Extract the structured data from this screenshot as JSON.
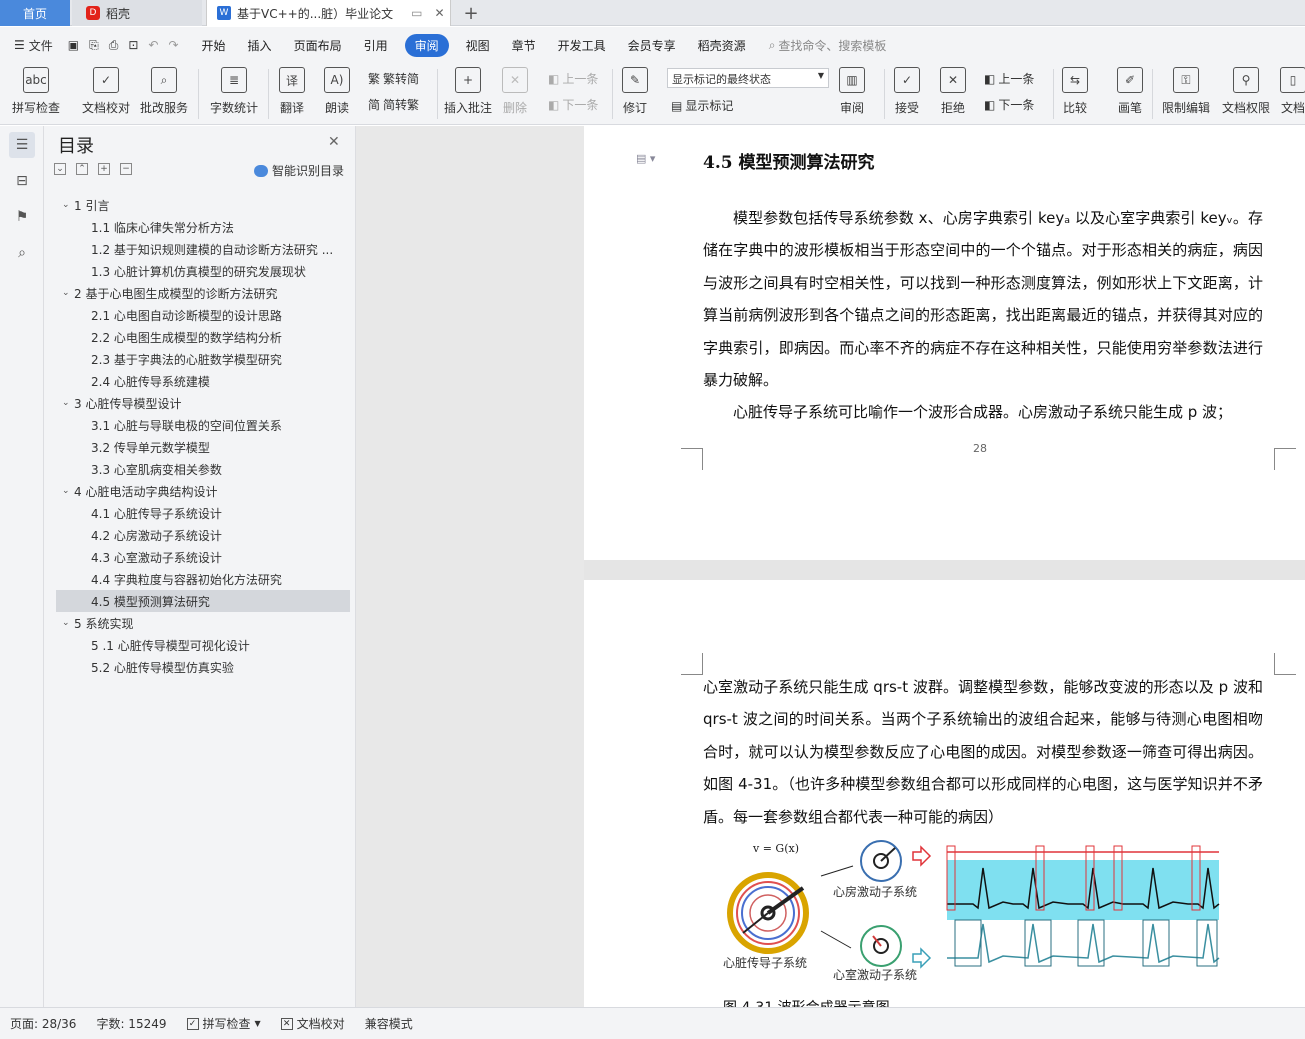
{
  "tabs": {
    "home": "首页",
    "daoke": "稻壳",
    "doc": "基于VC++的...脏）毕业论文",
    "add": "+"
  },
  "menubar": {
    "file": "文件",
    "items": [
      "开始",
      "插入",
      "页面布局",
      "引用",
      "审阅",
      "视图",
      "章节",
      "开发工具",
      "会员专享",
      "稻壳资源"
    ],
    "active": "审阅",
    "search": "查找命令、搜索模板"
  },
  "ribbon": {
    "spell": "拼写检查",
    "proof": "文档校对",
    "correct": "批改服务",
    "wordcount": "字数统计",
    "translate": "翻译",
    "read": "朗读",
    "t2s": "繁转简",
    "s2t": "简转繁",
    "comment": "插入批注",
    "delete": "删除",
    "prev": "上一条",
    "next": "下一条",
    "revise": "修订",
    "markup_mode": "显示标记的最终状态",
    "show_markup": "显示标记",
    "review": "审阅",
    "accept": "接受",
    "reject": "拒绝",
    "prev2": "上一条",
    "next2": "下一条",
    "compare": "比较",
    "pen": "画笔",
    "restrict": "限制编辑",
    "permission": "文档权限",
    "doc_more": "文档"
  },
  "toc": {
    "title": "目录",
    "smart": "智能识别目录",
    "items": [
      {
        "level": 1,
        "text": "1 引言"
      },
      {
        "level": 2,
        "text": "1.1 临床心律失常分析方法"
      },
      {
        "level": 2,
        "text": "1.2 基于知识规则建模的自动诊断方法研究 ..."
      },
      {
        "level": 2,
        "text": "1.3 心脏计算机仿真模型的研究发展现状"
      },
      {
        "level": 1,
        "text": "2 基于心电图生成模型的诊断方法研究"
      },
      {
        "level": 2,
        "text": "2.1 心电图自动诊断模型的设计思路"
      },
      {
        "level": 2,
        "text": "2.2 心电图生成模型的数学结构分析"
      },
      {
        "level": 2,
        "text": "2.3 基于字典法的心脏数学模型研究"
      },
      {
        "level": 2,
        "text": "2.4 心脏传导系统建模"
      },
      {
        "level": 1,
        "text": "3 心脏传导模型设计"
      },
      {
        "level": 2,
        "text": "3.1 心脏与导联电极的空间位置关系"
      },
      {
        "level": 2,
        "text": "3.2 传导单元数学模型"
      },
      {
        "level": 2,
        "text": "3.3 心室肌病变相关参数"
      },
      {
        "level": 1,
        "text": "4 心脏电活动字典结构设计"
      },
      {
        "level": 2,
        "text": "4.1 心脏传导子系统设计"
      },
      {
        "level": 2,
        "text": "4.2 心房激动子系统设计"
      },
      {
        "level": 2,
        "text": "4.3 心室激动子系统设计"
      },
      {
        "level": 2,
        "text": "4.4 字典粒度与容器初始化方法研究"
      },
      {
        "level": 2,
        "text": "4.5 模型预测算法研究",
        "selected": true
      },
      {
        "level": 1,
        "text": "5 系统实现"
      },
      {
        "level": 2,
        "text": "5 .1 心脏传导模型可视化设计"
      },
      {
        "level": 2,
        "text": "5.2 心脏传导模型仿真实验"
      }
    ]
  },
  "doc": {
    "heading": "4.5 模型预测算法研究",
    "p1": "模型参数包括传导系统参数 x、心房字典索引 keyₐ 以及心室字典索引 keyᵥ。存储在字典中的波形模板相当于形态空间中的一个个锚点。对于形态相关的病症，病因与波形之间具有时空相关性，可以找到一种形态测度算法，例如形状上下文距离，计算当前病例波形到各个锚点之间的形态距离，找出距离最近的锚点，并获得其对应的字典索引，即病因。而心率不齐的病症不存在这种相关性，只能使用穷举参数法进行暴力破解。",
    "p2": "心脏传导子系统可比喻作一个波形合成器。心房激动子系统只能生成 p 波；",
    "page_num": "28",
    "p3": "心室激动子系统只能生成 qrs-t 波群。调整模型参数，能够改变波的形态以及 p 波和 qrs-t 波之间的时间关系。当两个子系统输出的波组合起来，能够与待测心电图相吻合时，就可以认为模型参数反应了心电图的成因。对模型参数逐一筛查可得出病因。如图 4-31。（也许多种模型参数组合都可以形成同样的心电图，这与医学知识并不矛盾。每一套参数组合都代表一种可能的病因）",
    "fig_formula": "v = G(x)",
    "fig_atrial": "心房激动子系统",
    "fig_ventricular": "心室激动子系统",
    "fig_conduction": "心脏传导子系统",
    "caption": "图 4-31 波形合成器示意图"
  },
  "status": {
    "page": "页面: 28/36",
    "words": "字数: 15249",
    "spell": "拼写检查",
    "proof": "文档校对",
    "compat": "兼容模式"
  },
  "colors": {
    "accent": "#2a6fd6",
    "ecg_band": "#7fe0f0",
    "red": "#e0343a",
    "teal": "#3a8fa0"
  }
}
